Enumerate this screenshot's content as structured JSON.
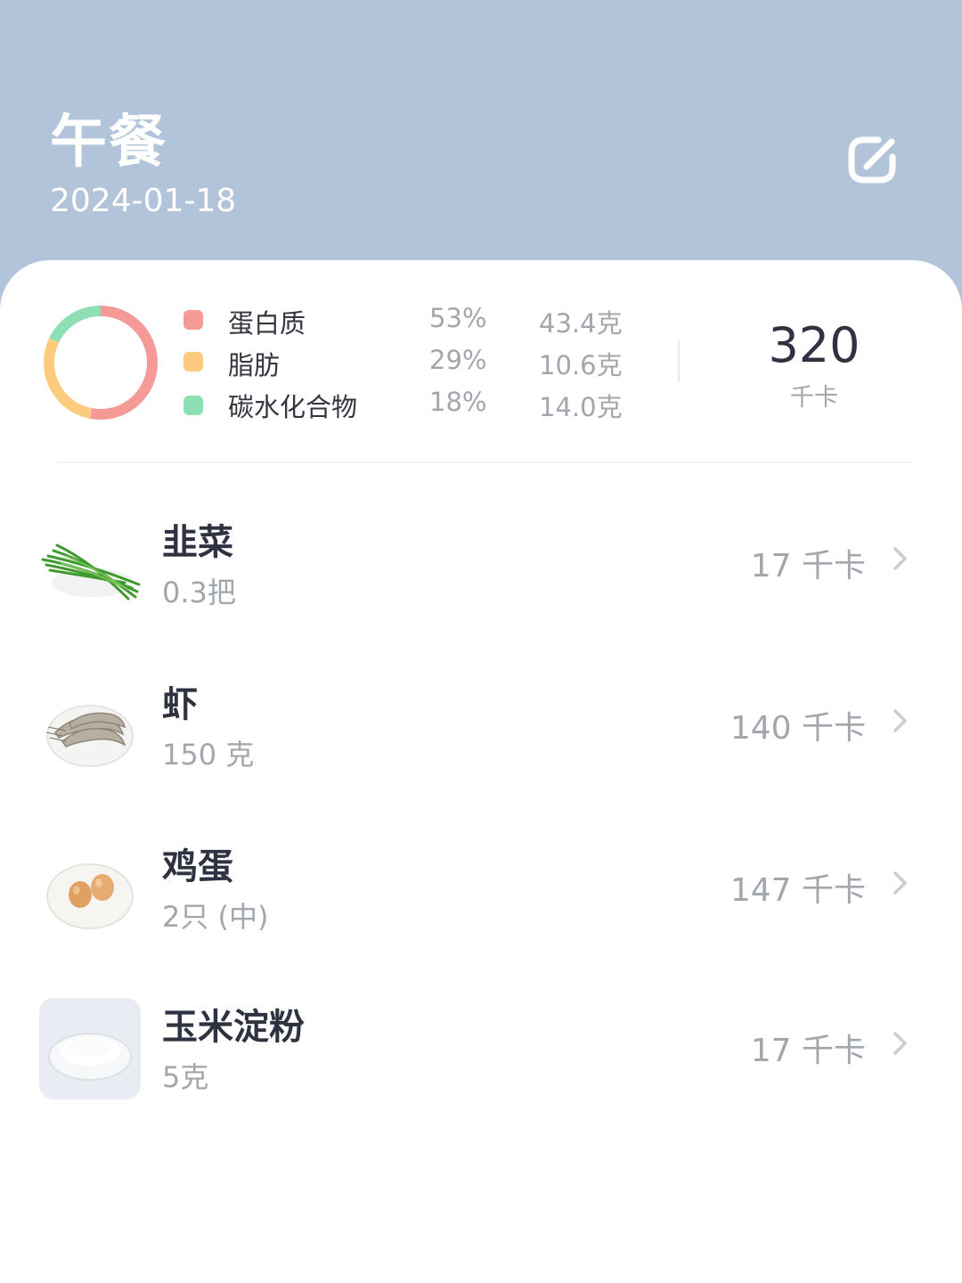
{
  "header": {
    "title": "午餐",
    "date": "2024-01-18",
    "background_color": "#b2c4d9",
    "edit_icon": "edit-icon"
  },
  "summary": {
    "macros": [
      {
        "name": "蛋白质",
        "percent": "53%",
        "grams": "43.4克",
        "color": "#f59a97",
        "fraction": 0.53
      },
      {
        "name": "脂肪",
        "percent": "29%",
        "grams": "10.6克",
        "color": "#fccb7e",
        "fraction": 0.29
      },
      {
        "name": "碳水化合物",
        "percent": "18%",
        "grams": "14.0克",
        "color": "#8fdfb5",
        "fraction": 0.18
      }
    ],
    "total_kcal": "320",
    "total_unit": "千卡"
  },
  "foods": [
    {
      "name": "韭菜",
      "amount": "0.3把",
      "kcal": "17 千卡",
      "thumb_icon": "chives-image"
    },
    {
      "name": "虾",
      "amount": "150 克",
      "kcal": "140 千卡",
      "thumb_icon": "shrimp-image"
    },
    {
      "name": "鸡蛋",
      "amount": "2只 (中)",
      "kcal": "147 千卡",
      "thumb_icon": "eggs-image"
    },
    {
      "name": "玉米淀粉",
      "amount": "5克",
      "kcal": "17 千卡",
      "thumb_icon": "cornstarch-image"
    }
  ]
}
